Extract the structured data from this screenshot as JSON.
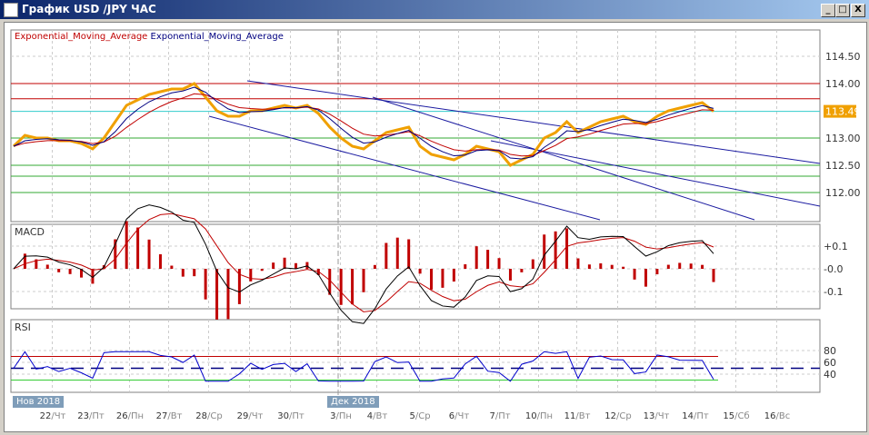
{
  "window": {
    "title": "График USD /JPY  ЧАС",
    "minimize": "_",
    "maximize": "□",
    "close": "X"
  },
  "legend": [
    {
      "label": "Exponential_Moving_Average",
      "color": "#c00000"
    },
    {
      "label": "Exponential_Moving_Average",
      "color": "#000080"
    }
  ],
  "current_price": "113.49",
  "chart_data": [
    {
      "type": "line",
      "title": "USD/JPY H1",
      "ylim": [
        111.5,
        115.0
      ],
      "yticks": [
        "114.50",
        "114.00",
        "113.00",
        "112.50",
        "112.00"
      ],
      "price": [
        112.85,
        113.05,
        113.0,
        113.0,
        112.95,
        112.95,
        112.9,
        112.8,
        113.0,
        113.3,
        113.6,
        113.7,
        113.8,
        113.85,
        113.9,
        113.9,
        114.0,
        113.75,
        113.5,
        113.4,
        113.4,
        113.5,
        113.5,
        113.55,
        113.6,
        113.55,
        113.6,
        113.45,
        113.2,
        113.0,
        112.85,
        112.8,
        112.95,
        113.1,
        113.15,
        113.2,
        112.85,
        112.7,
        112.65,
        112.6,
        112.7,
        112.85,
        112.8,
        112.75,
        112.5,
        112.6,
        112.7,
        113.0,
        113.1,
        113.3,
        113.1,
        113.2,
        113.3,
        113.35,
        113.4,
        113.3,
        113.25,
        113.4,
        113.5,
        113.55,
        113.6,
        113.65,
        113.49
      ],
      "hlines": [
        {
          "price": 114.0,
          "color": "#c00000"
        },
        {
          "price": 113.72,
          "color": "#c00000"
        },
        {
          "price": 113.49,
          "color": "#33cccc"
        },
        {
          "price": 113.0,
          "color": "#33aa33"
        },
        {
          "price": 112.5,
          "color": "#33aa33"
        },
        {
          "price": 112.3,
          "color": "#33aa33"
        },
        {
          "price": 112.0,
          "color": "#33aa33"
        }
      ]
    },
    {
      "type": "line",
      "title": "MACD",
      "yticks": [
        "+0.1",
        "-0.0",
        "-0.1"
      ]
    },
    {
      "type": "line",
      "title": "RSI",
      "yticks": [
        "80",
        "60",
        "40"
      ],
      "levels": [
        70,
        50,
        30
      ]
    }
  ],
  "xaxis": {
    "months": [
      "Нов 2018",
      "Дек 2018"
    ],
    "ticks": [
      [
        "22",
        "/Чт"
      ],
      [
        "23",
        "/Пт"
      ],
      [
        "26",
        "/Пн"
      ],
      [
        "27",
        "/Вт"
      ],
      [
        "28",
        "/Ср"
      ],
      [
        "29",
        "/Чт"
      ],
      [
        "30",
        "/Пт"
      ],
      [
        "3",
        "/Пн"
      ],
      [
        "4",
        "/Вт"
      ],
      [
        "5",
        "/Ср"
      ],
      [
        "6",
        "/Чт"
      ],
      [
        "7",
        "/Пт"
      ],
      [
        "10",
        "/Пн"
      ],
      [
        "11",
        "/Вт"
      ],
      [
        "12",
        "/Ср"
      ],
      [
        "13",
        "/Чт"
      ],
      [
        "14",
        "/Пт"
      ],
      [
        "15",
        "/Сб"
      ],
      [
        "16",
        "/Вс"
      ]
    ]
  }
}
